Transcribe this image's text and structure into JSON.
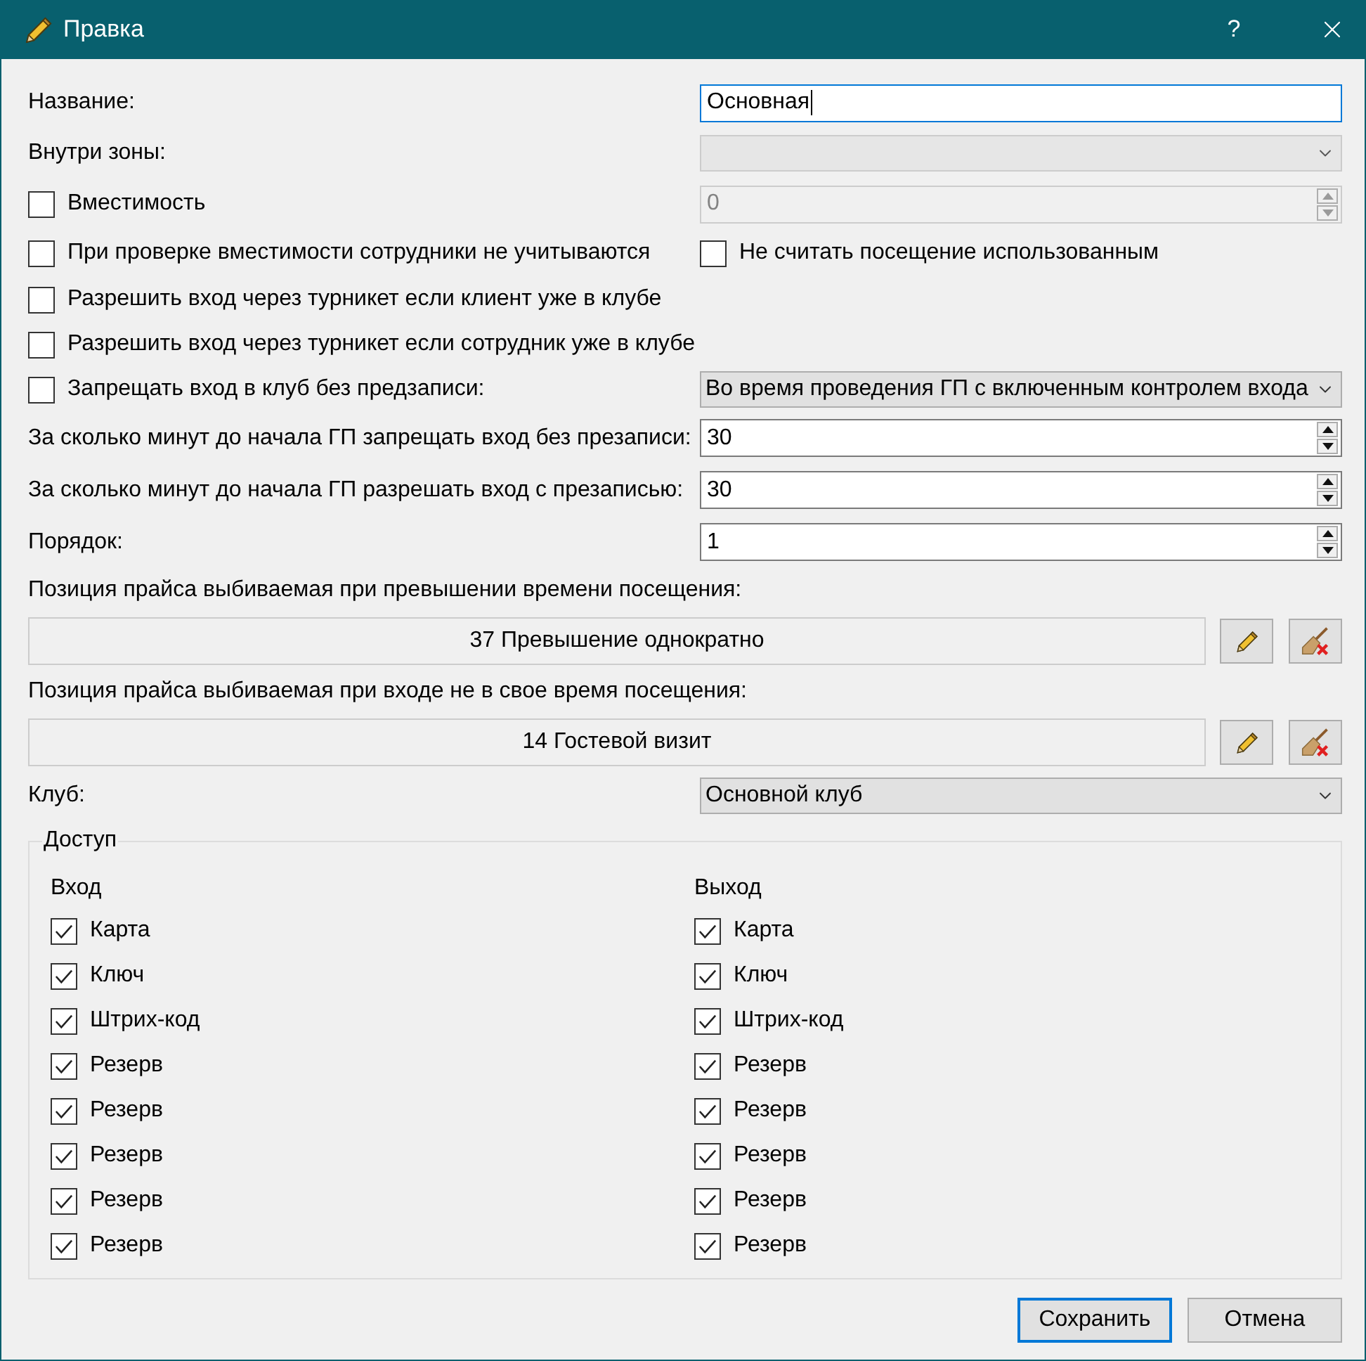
{
  "window": {
    "title": "Правка",
    "help": "?"
  },
  "fields": [
    {
      "kind": "text",
      "label": "Название:",
      "value": "Основная",
      "focused": true
    },
    {
      "kind": "combo",
      "label": "Внутри зоны:",
      "disabled": true
    },
    {
      "kind": "check_spin",
      "label": "Вместимость",
      "checked": false,
      "value": "0",
      "disabled": true
    },
    {
      "kind": "check_pair",
      "items": [
        {
          "label": "При проверке вместимости сотрудники не учитываются",
          "checked": false
        },
        {
          "label": "Не считать посещение использованным",
          "checked": false
        }
      ]
    },
    {
      "kind": "check",
      "label": "Разрешить вход через турникет если клиент уже в клубе",
      "checked": false
    },
    {
      "kind": "check",
      "label": "Разрешить вход через турникет если сотрудник уже в клубе",
      "checked": false
    },
    {
      "kind": "check_combo",
      "label": "Запрещать вход в клуб без предзаписи:",
      "checked": false,
      "value": "Во время проведения ГП с включенным контролем входа",
      "disabled": false
    },
    {
      "kind": "spin",
      "label": "За сколько минут до начала ГП запрещать вход без презаписи:",
      "value": "30",
      "disabled": false
    },
    {
      "kind": "spin",
      "label": "За сколько минут до начала ГП разрешать вход с презаписью:",
      "value": "30",
      "disabled": false
    },
    {
      "kind": "spin",
      "label": "Порядок:",
      "value": "1",
      "disabled": false
    },
    {
      "kind": "price",
      "label": "Позиция прайса выбиваемая при превышении времени посещения:",
      "value": "37 Превышение однократно"
    },
    {
      "kind": "price",
      "label": "Позиция прайса выбиваемая при входе не в свое время посещения:",
      "value": "14 Гостевой визит"
    },
    {
      "kind": "combo",
      "label": "Клуб:",
      "value": "Основной клуб",
      "disabled": false
    }
  ],
  "access": {
    "title": "Доступ",
    "columns": [
      {
        "title": "Вход",
        "items": [
          {
            "label": "Карта",
            "checked": true
          },
          {
            "label": "Ключ",
            "checked": true
          },
          {
            "label": "Штрих-код",
            "checked": true
          },
          {
            "label": "Резерв",
            "checked": true
          },
          {
            "label": "Резерв",
            "checked": true
          },
          {
            "label": "Резерв",
            "checked": true
          },
          {
            "label": "Резерв",
            "checked": true
          },
          {
            "label": "Резерв",
            "checked": true
          }
        ]
      },
      {
        "title": "Выход",
        "items": [
          {
            "label": "Карта",
            "checked": true
          },
          {
            "label": "Ключ",
            "checked": true
          },
          {
            "label": "Штрих-код",
            "checked": true
          },
          {
            "label": "Резерв",
            "checked": true
          },
          {
            "label": "Резерв",
            "checked": true
          },
          {
            "label": "Резерв",
            "checked": true
          },
          {
            "label": "Резерв",
            "checked": true
          },
          {
            "label": "Резерв",
            "checked": true
          }
        ]
      }
    ]
  },
  "buttons": [
    {
      "label": "Сохранить",
      "default": true
    },
    {
      "label": "Отмена",
      "default": false
    }
  ]
}
